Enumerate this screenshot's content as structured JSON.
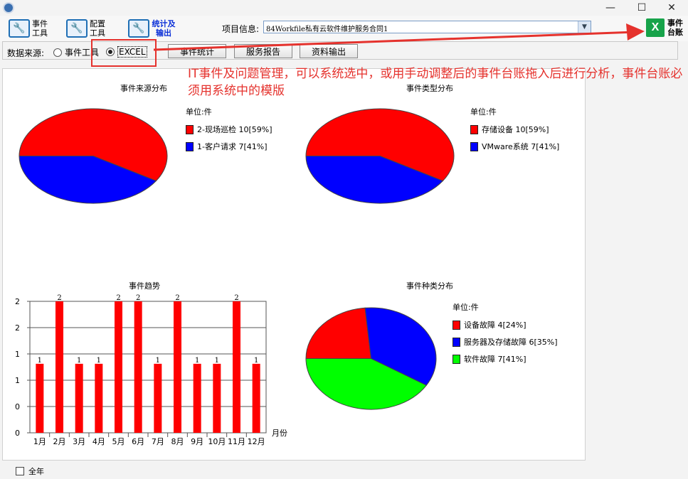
{
  "toolbar": {
    "event_tool": "事件\n工具",
    "config_tool": "配置\n工具",
    "stats_output": "统计及\n输出",
    "project_label": "项目信息:",
    "project_value": "84Workfile私有云软件维护服务合同1",
    "event_ledger": "事件\n台账"
  },
  "options": {
    "source_label": "数据来源:",
    "radio_event_tool": "事件工具",
    "radio_excel": "EXCEL",
    "selected": "EXCEL",
    "btn_stats": "事件统计",
    "btn_report": "服务报告",
    "btn_export": "资料输出"
  },
  "annotation": {
    "text": "IT事件及问题管理，可以系统选中，或用手动调整后的事件台账拖入后进行分析，事件台账必须用系统中的模版"
  },
  "footer": {
    "all_year": "全年"
  },
  "colors": {
    "red": "#ff0000",
    "blue": "#0000ff",
    "green": "#00ff00",
    "annotation": "#e5322d"
  },
  "chart_data": [
    {
      "type": "pie",
      "title": "事件来源分布",
      "unit": "单位:件",
      "slices": [
        {
          "label": "2-现场巡检 10[59%]",
          "value": 10,
          "color": "#ff0000"
        },
        {
          "label": "1-客户请求 7[41%]",
          "value": 7,
          "color": "#0000ff"
        }
      ]
    },
    {
      "type": "pie",
      "title": "事件类型分布",
      "unit": "单位:件",
      "slices": [
        {
          "label": "存储设备 10[59%]",
          "value": 10,
          "color": "#ff0000"
        },
        {
          "label": "VMware系统 7[41%]",
          "value": 7,
          "color": "#0000ff"
        }
      ]
    },
    {
      "type": "bar",
      "title": "事件趋势",
      "categories": [
        "1月",
        "2月",
        "3月",
        "4月",
        "5月",
        "6月",
        "7月",
        "8月",
        "9月",
        "10月",
        "11月",
        "12月"
      ],
      "values": [
        1,
        2,
        1,
        1,
        2,
        2,
        1,
        2,
        1,
        1,
        2,
        1
      ],
      "xlabel": "月份",
      "ylabel": "",
      "ylim": [
        0,
        2
      ],
      "yticks": [
        "0",
        "0",
        "1",
        "1",
        "2",
        "2"
      ],
      "grid": true,
      "color": "#ff0000"
    },
    {
      "type": "pie",
      "title": "事件种类分布",
      "unit": "单位:件",
      "slices": [
        {
          "label": "设备故障 4[24%]",
          "value": 4,
          "color": "#ff0000"
        },
        {
          "label": "服务器及存储故障 6[35%]",
          "value": 6,
          "color": "#0000ff"
        },
        {
          "label": "软件故障 7[41%]",
          "value": 7,
          "color": "#00ff00"
        }
      ]
    }
  ]
}
